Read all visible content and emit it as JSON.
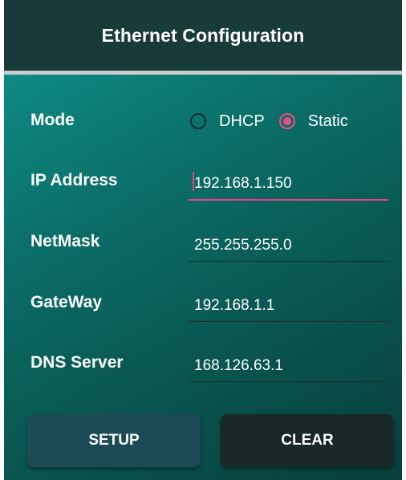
{
  "header": {
    "title": "Ethernet Configuration"
  },
  "form": {
    "mode": {
      "label": "Mode",
      "options": [
        {
          "label": "DHCP",
          "selected": false
        },
        {
          "label": "Static",
          "selected": true
        }
      ]
    },
    "ip_address": {
      "label": "IP Address",
      "value": "192.168.1.150"
    },
    "netmask": {
      "label": "NetMask",
      "value": "255.255.255.0"
    },
    "gateway": {
      "label": "GateWay",
      "value": "192.168.1.1"
    },
    "dns_server": {
      "label": "DNS Server",
      "value": "168.126.63.1"
    }
  },
  "buttons": {
    "setup": "SETUP",
    "clear": "CLEAR"
  },
  "colors": {
    "accent": "#ee4b84",
    "title_bar": "#173b38",
    "content_gradient_start": "#0e8a84",
    "content_gradient_end": "#073f3c",
    "setup_button": "#1c4b55",
    "clear_button": "#172826"
  }
}
